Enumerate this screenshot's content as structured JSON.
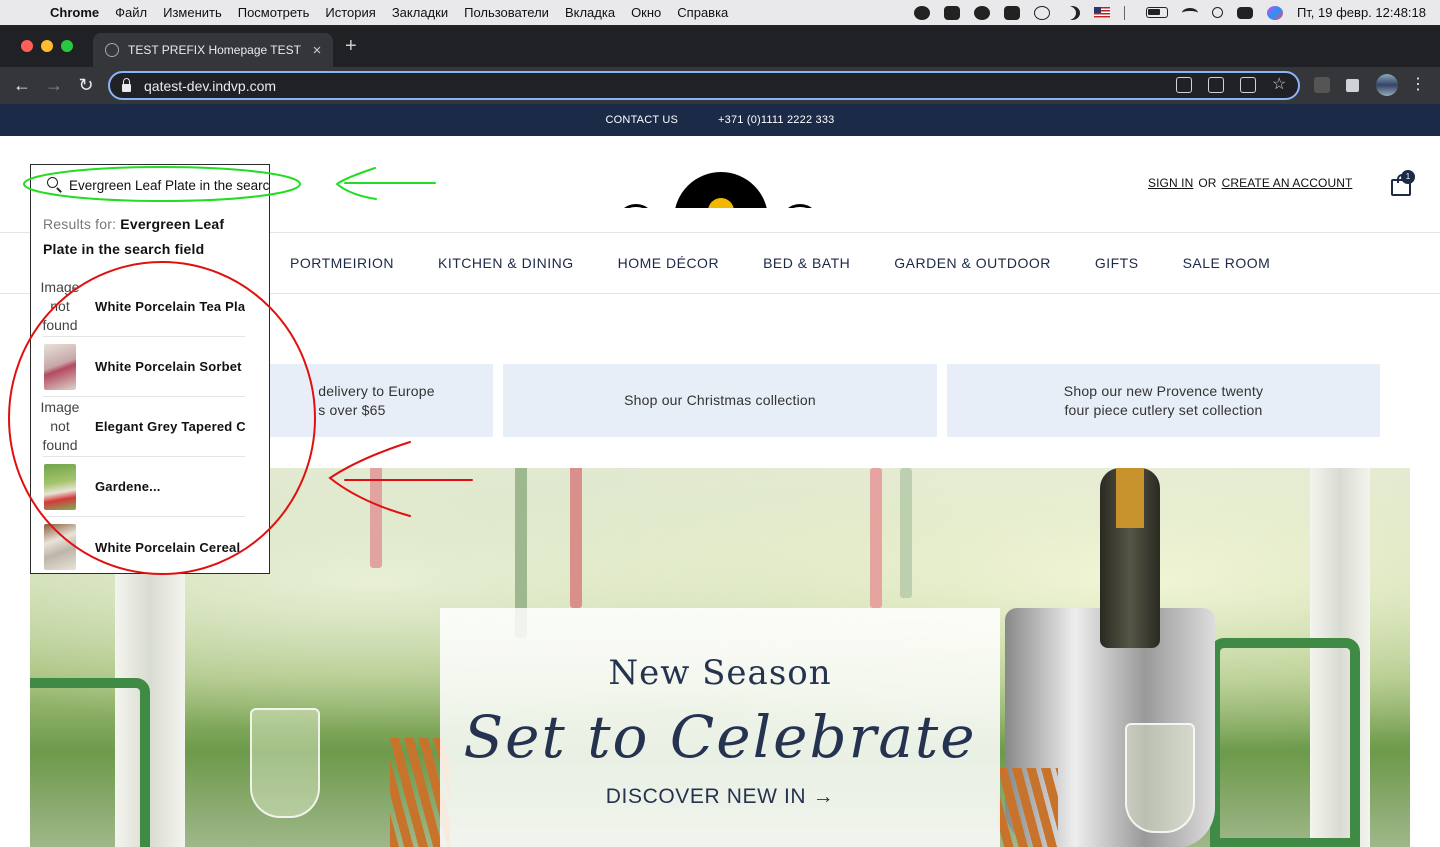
{
  "menubar": {
    "app": "Chrome",
    "items": [
      "Файл",
      "Изменить",
      "Посмотреть",
      "История",
      "Закладки",
      "Пользователи",
      "Вкладка",
      "Окно",
      "Справка"
    ],
    "datetime": "Пт, 19 февр.  12:48:18"
  },
  "browser": {
    "tab_title": "TEST PREFIX Homepage TEST",
    "url": "qatest-dev.indvp.com"
  },
  "topbar": {
    "contact": "CONTACT US",
    "phone": "+371 (0)1111 2222 333"
  },
  "header": {
    "sign_in": "SIGN IN",
    "or": "OR",
    "create_account": "CREATE AN ACCOUNT",
    "cart_count": "1"
  },
  "nav": {
    "items": [
      "PORTMEIRION",
      "KITCHEN & DINING",
      "HOME DÉCOR",
      "BED & BATH",
      "GARDEN & OUTDOOR",
      "GIFTS",
      "SALE ROOM"
    ]
  },
  "promos": [
    {
      "line1": "delivery to Europe",
      "line2": "s over $65"
    },
    {
      "line1": "Shop our Christmas collection",
      "line2": ""
    },
    {
      "line1": "Shop our new Provence twenty",
      "line2": "four piece cutlery set collection"
    }
  ],
  "hero": {
    "eyebrow": "New Season",
    "headline": "Set to Celebrate",
    "cta": "DISCOVER NEW IN →"
  },
  "search": {
    "value": "Evergreen Leaf Plate in the search field",
    "results_label": "Results for:",
    "query": "Evergreen Leaf Plate in the search field",
    "results": [
      {
        "image": "Image not found",
        "name": "White Porcelain Tea Pla..."
      },
      {
        "image": "",
        "name": "White Porcelain Sorbet Bowl"
      },
      {
        "image": "Image not found",
        "name": "Elegant Grey Tapered Candle"
      },
      {
        "image": "",
        "name": "Gardene..."
      },
      {
        "image": "",
        "name": "White Porcelain Cereal Bowl"
      }
    ]
  },
  "colors": {
    "brand_navy": "#1b2a47",
    "promo_bg": "#e8eef7",
    "annotation_green": "#22dd22",
    "annotation_red": "#e01010"
  }
}
